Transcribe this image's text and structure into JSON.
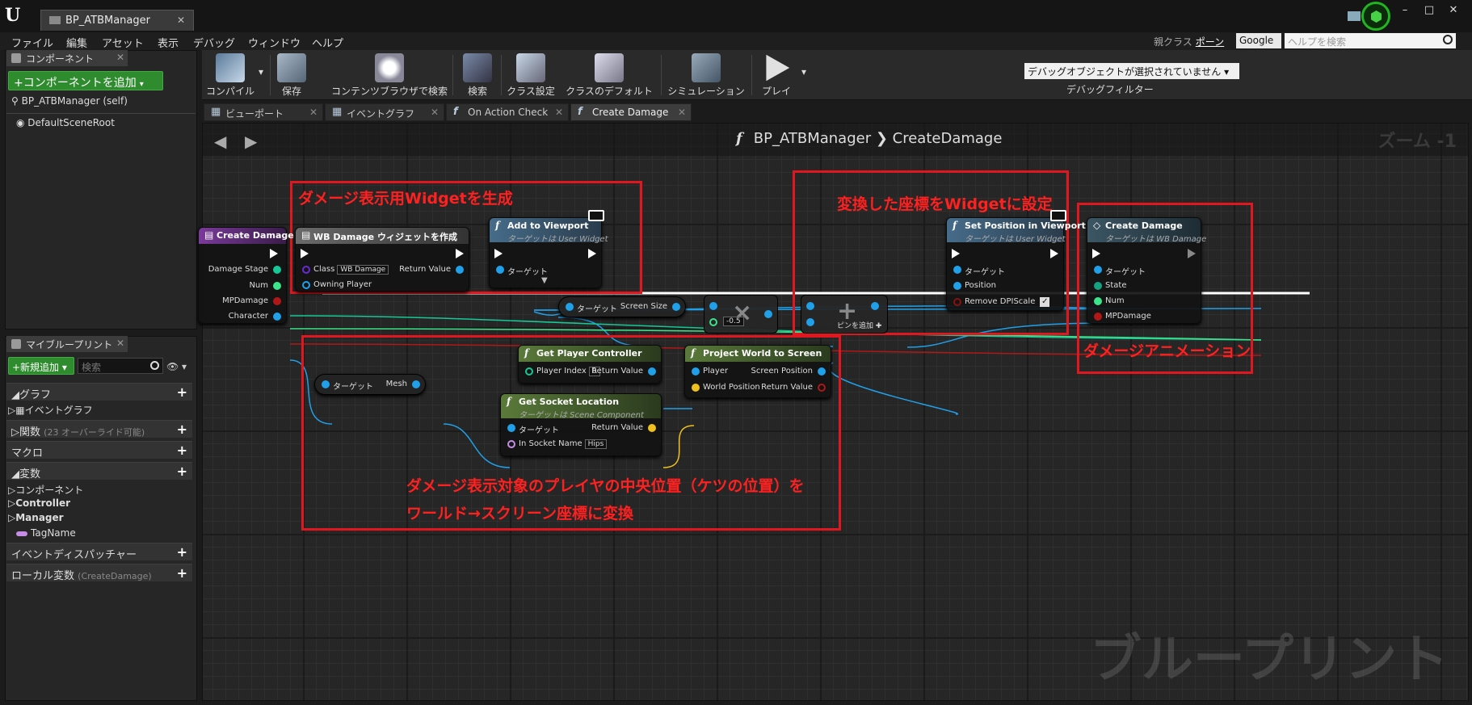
{
  "window": {
    "tab_title": "BP_ATBManager",
    "buttons": [
      "–",
      "□",
      "✕"
    ]
  },
  "menu": {
    "items": [
      "ファイル",
      "編集",
      "アセット",
      "表示",
      "デバッグ",
      "ウィンドウ",
      "ヘルプ"
    ],
    "parent_class_label": "親クラス",
    "parent_class_value": "ポーン",
    "search_engine": "Google",
    "help_placeholder": "ヘルプを検索"
  },
  "components_panel": {
    "tab": "コンポーネント",
    "add_button": "+コンポーネントを追加",
    "items": [
      "BP_ATBManager (self)",
      "DefaultSceneRoot"
    ]
  },
  "myblueprint": {
    "tab": "マイブループリント",
    "add_button": "+新規追加",
    "search_placeholder": "検索",
    "categories": {
      "graph": "グラフ",
      "event_graph": "イベントグラフ",
      "functions": "関数",
      "functions_sub": "(23 オーバーライド可能)",
      "macros": "マクロ",
      "variables": "変数",
      "dispatchers": "イベントディスパッチャー",
      "local_vars": "ローカル変数",
      "local_vars_sub": "(CreateDamage)"
    },
    "var_items": [
      "コンポーネント",
      "Controller",
      "Manager",
      "TagName"
    ]
  },
  "toolbar": {
    "compile": "コンパイル",
    "save": "保存",
    "browse": "コンテンツブラウザで検索",
    "find": "検索",
    "class_settings": "クラス設定",
    "class_defaults": "クラスのデフォルト",
    "simulation": "シミュレーション",
    "play": "プレイ",
    "debug_object": "デバッグオブジェクトが選択されていません",
    "debug_filter": "デバッグフィルター"
  },
  "graph_tabs": [
    "ビューポート",
    "イベントグラフ",
    "On Action Check",
    "Create Damage"
  ],
  "graph": {
    "crumb_bp": "BP_ATBManager",
    "crumb_fn": "CreateDamage",
    "zoom": "ズーム -1",
    "watermark": "ブループリント"
  },
  "annotations": {
    "box1": "ダメージ表示用Widgetを生成",
    "box2": "変換した座標をWidgetに設定",
    "box3": "ダメージアニメーション",
    "box4_line1": "ダメージ表示対象のプレイヤの中央位置（ケツの位置）を",
    "box4_line2": "ワールド→スクリーン座標に変換"
  },
  "nodes": {
    "entry": {
      "title": "Create Damage",
      "pins": [
        "Damage Stage",
        "Num",
        "MPDamage",
        "Character"
      ]
    },
    "create_widget": {
      "title": "WB Damage ウィジェットを作成",
      "class_label": "Class",
      "class_value": "WB Damage",
      "owner": "Owning Player",
      "ret": "Return Value"
    },
    "add_viewport": {
      "title": "Add to Viewport",
      "sub": "ターゲットは User Widget",
      "target": "ターゲット"
    },
    "set_pos": {
      "title": "Set Position in Viewport",
      "sub": "ターゲットは User Widget",
      "target": "ターゲット",
      "position": "Position",
      "dpi": "Remove DPIScale"
    },
    "create_damage_call": {
      "title": "Create Damage",
      "sub": "ターゲットは WB Damage",
      "target": "ターゲット",
      "state": "State",
      "num": "Num",
      "mp": "MPDamage"
    },
    "screen_size": {
      "target": "ターゲット",
      "out": "Screen Size"
    },
    "multiply": {
      "value": "-0.5"
    },
    "add": {
      "label": "ピンを追加"
    },
    "mesh": {
      "target": "ターゲット",
      "out": "Mesh"
    },
    "get_pc": {
      "title": "Get Player Controller",
      "idx_label": "Player Index",
      "idx_value": "0",
      "ret": "Return Value"
    },
    "proj": {
      "title": "Project World to Screen",
      "player": "Player",
      "world": "World Position",
      "screen": "Screen Position",
      "ret": "Return Value"
    },
    "socket": {
      "title": "Get Socket Location",
      "sub": "ターゲットは Scene Component",
      "target": "ターゲット",
      "name_label": "In Socket Name",
      "name_value": "Hips",
      "ret": "Return Value"
    }
  }
}
